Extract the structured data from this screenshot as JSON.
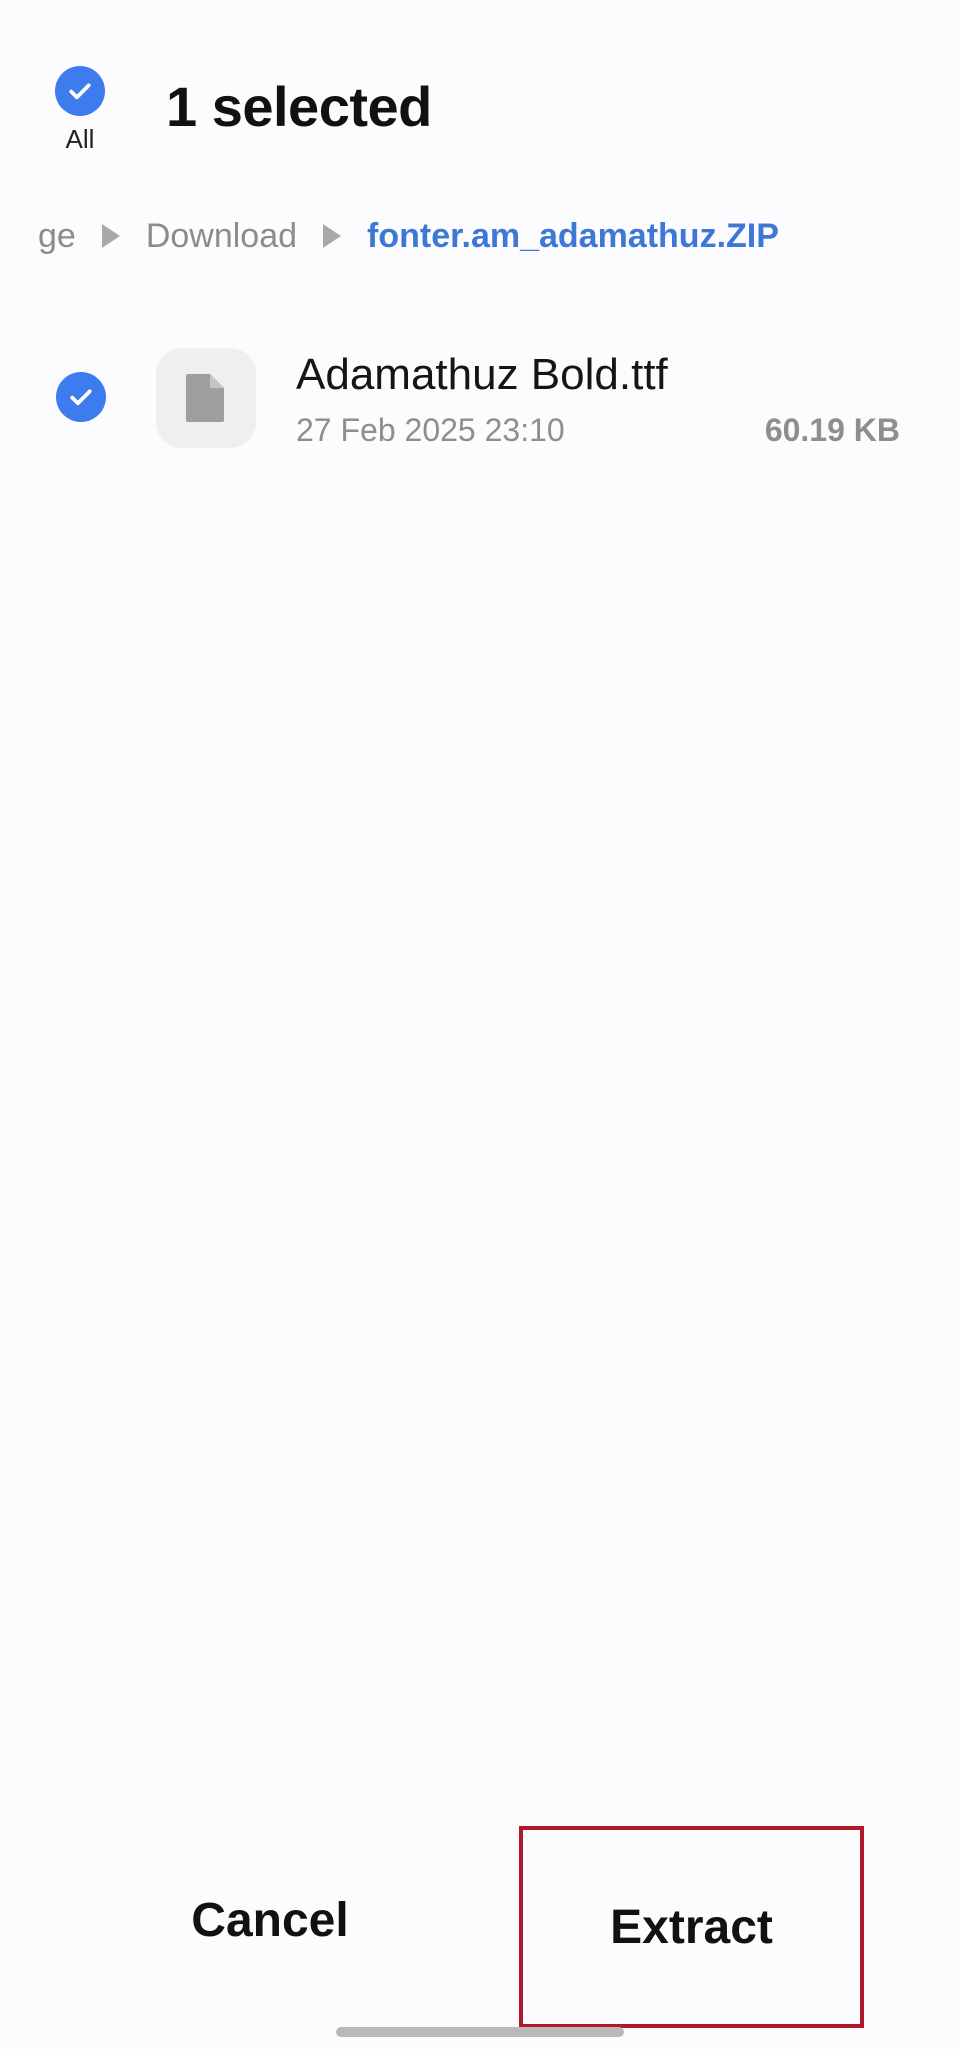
{
  "header": {
    "select_all_label": "All",
    "title": "1 selected"
  },
  "breadcrumb": {
    "items": [
      "ge",
      "Download"
    ],
    "current": "fonter.am_adamathuz.ZIP"
  },
  "files": [
    {
      "name": "Adamathuz Bold.ttf",
      "date": "27 Feb 2025 23:10",
      "size": "60.19 KB",
      "selected": true,
      "icon": "file-icon"
    }
  ],
  "actions": {
    "cancel_label": "Cancel",
    "extract_label": "Extract"
  },
  "colors": {
    "accent": "#3d7bef",
    "current_crumb": "#3d78d6",
    "highlight_box": "#b0192a"
  }
}
